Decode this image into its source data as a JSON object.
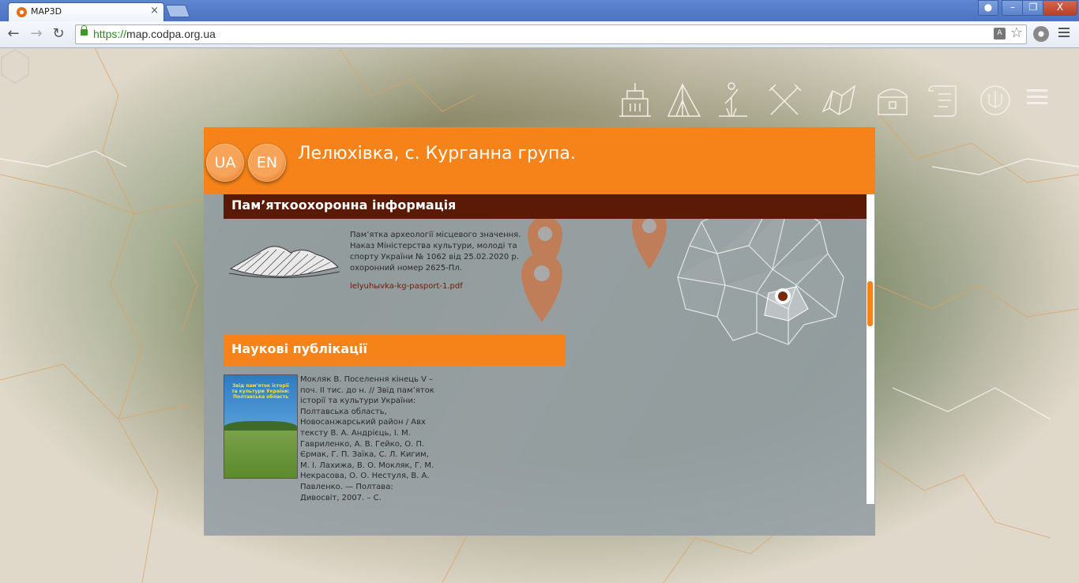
{
  "browser": {
    "tab_title": "MAP3D",
    "url_scheme": "https://",
    "url_rest": "map.codpa.org.ua",
    "controls": {
      "minimize": "–",
      "maximize": "❐",
      "close": "X"
    }
  },
  "panel": {
    "lang_ua": "UA",
    "lang_en": "EN",
    "title": "Лелюхівка, с. Курганна група.",
    "section1_title": "Пам’яткоохоронна інформація",
    "info_lines": [
      "Пам’ятка археології місцевого значення.",
      "Наказ Міністерства культури, молоді та",
      "спорту України № 1062 від 25.02.2020 р.",
      "охоронний номер 2625-Пл."
    ],
    "pdf_link": "lelyuhыvka-kg-pasport-1.pdf",
    "section2_title": "Наукові публікації",
    "book_cover_title": "Звід пам’яток історії та культури України: Полтавська область",
    "publication": "Мокляк В. Поселення кінець V – поч. ІІ тис. до н. // Звід пам’яток історії та культури України: Полтавська область, Новосанжарський район / Авх тексту В. А. Андрієць, І. М. Гавриленко, А. В. Гейко, О. П. Єрмак, Г. П. Заїка, С. Л. Кигим, М. І. Лахижа, В. О. Мокляк, Г. М. Некрасова, О. О. Нестуля, В. А. Павленко. — Полтава: Дивосвіт, 2007. – С."
  },
  "colors": {
    "accent_orange": "#f58319",
    "section_dark": "#5a1a06",
    "link": "#6b1b08"
  },
  "icons": [
    "building-icon",
    "tent-icon",
    "statue-icon",
    "weapons-icon",
    "map-icon",
    "chest-icon",
    "scroll-icon",
    "emblem-icon",
    "menu-icon",
    "facebook-icon"
  ]
}
